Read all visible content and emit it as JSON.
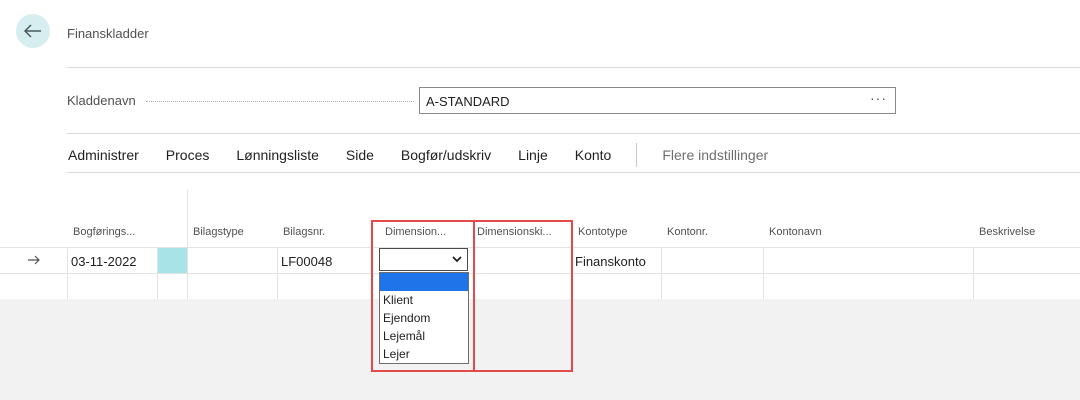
{
  "header": {
    "title": "Finanskladder"
  },
  "batch": {
    "label": "Kladdenavn",
    "value": "A-STANDARD",
    "more_label": "···"
  },
  "menu": {
    "items": [
      "Administrer",
      "Proces",
      "Lønningsliste",
      "Side",
      "Bogfør/udskriv",
      "Linje",
      "Konto"
    ],
    "more": "Flere indstillinger"
  },
  "columns": {
    "posting_date": "Bogførings...",
    "document_type": "Bilagstype",
    "document_no": "Bilagsnr.",
    "dimension": "Dimension...",
    "dimension_code": "Dimensionski...",
    "account_type": "Kontotype",
    "account_no": "Kontonr.",
    "account_name": "Kontonavn",
    "description": "Beskrivelse"
  },
  "row": {
    "posting_date": "03-11-2022",
    "document_no": "LF00048",
    "dimension": "",
    "account_type": "Finanskonto"
  },
  "dropdown": {
    "options": [
      "",
      "Klient",
      "Ejendom",
      "Lejemål",
      "Lejer"
    ]
  },
  "colors": {
    "accent": "#a8e4e7",
    "highlight": "#1e74e8",
    "annotation": "#e34a4a"
  }
}
